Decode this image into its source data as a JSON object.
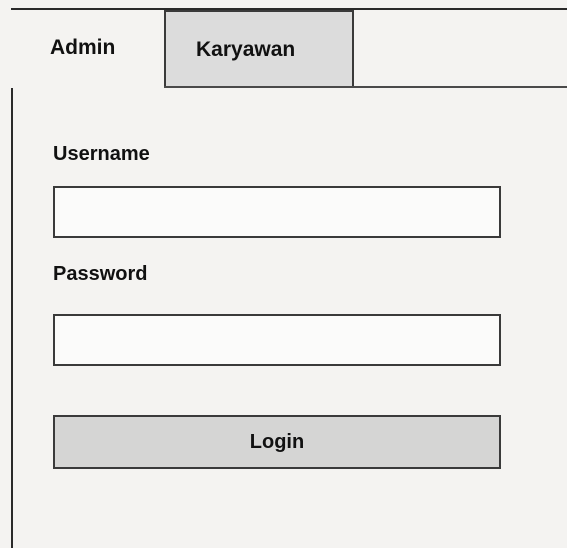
{
  "tabs": [
    {
      "label": "Admin",
      "active": true
    },
    {
      "label": "Karyawan",
      "active": false
    }
  ],
  "form": {
    "username_label": "Username",
    "username_value": "",
    "password_label": "Password",
    "password_value": "",
    "login_label": "Login"
  },
  "colors": {
    "background": "#f4f3f1",
    "inactive_tab": "#dcdcdc",
    "button": "#d5d5d4",
    "border": "#3a3a3a"
  }
}
